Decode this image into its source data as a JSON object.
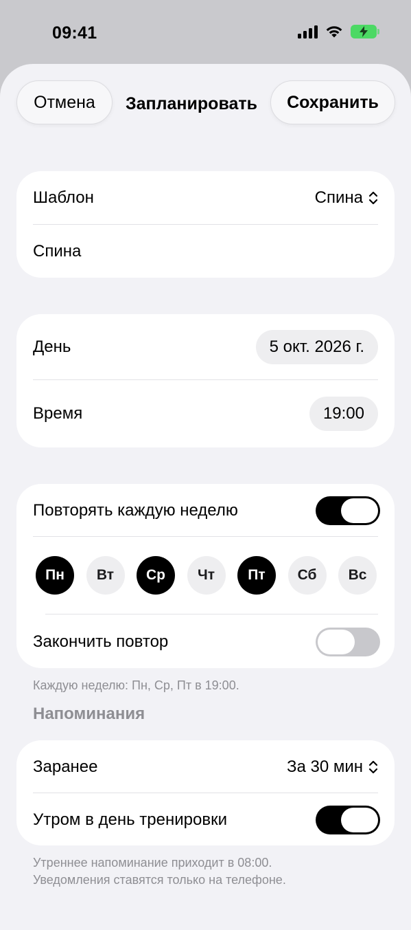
{
  "status_bar": {
    "time": "09:41"
  },
  "nav": {
    "cancel_label": "Отмена",
    "title": "Запланировать",
    "save_label": "Сохранить"
  },
  "template_card": {
    "template_label": "Шаблон",
    "template_value": "Спина",
    "name_value": "Спина"
  },
  "schedule_card": {
    "day_label": "День",
    "day_value": "5 окт. 2026 г.",
    "time_label": "Время",
    "time_value": "19:00"
  },
  "repeat_card": {
    "repeat_label": "Повторять каждую неделю",
    "repeat_on": true,
    "days": [
      {
        "label": "Пн",
        "selected": true
      },
      {
        "label": "Вт",
        "selected": false
      },
      {
        "label": "Ср",
        "selected": true
      },
      {
        "label": "Чт",
        "selected": false
      },
      {
        "label": "Пт",
        "selected": true
      },
      {
        "label": "Сб",
        "selected": false
      },
      {
        "label": "Вс",
        "selected": false
      }
    ],
    "end_repeat_label": "Закончить повтор",
    "end_repeat_on": false
  },
  "repeat_footnote": "Каждую неделю: Пн, Ср, Пт в 19:00.",
  "reminders": {
    "header": "Напоминания",
    "advance_label": "Заранее",
    "advance_value": "За 30 мин",
    "morning_label": "Утром в день тренировки",
    "morning_on": true,
    "footnote_line1": "Утреннее напоминание приходит в 08:00.",
    "footnote_line2": "Уведомления ставятся только на телефоне."
  },
  "colors": {
    "accent": "#000000",
    "background": "#f2f2f6",
    "card": "#ffffff",
    "secondary_text": "#8e8e93",
    "battery": "#4cd964"
  }
}
